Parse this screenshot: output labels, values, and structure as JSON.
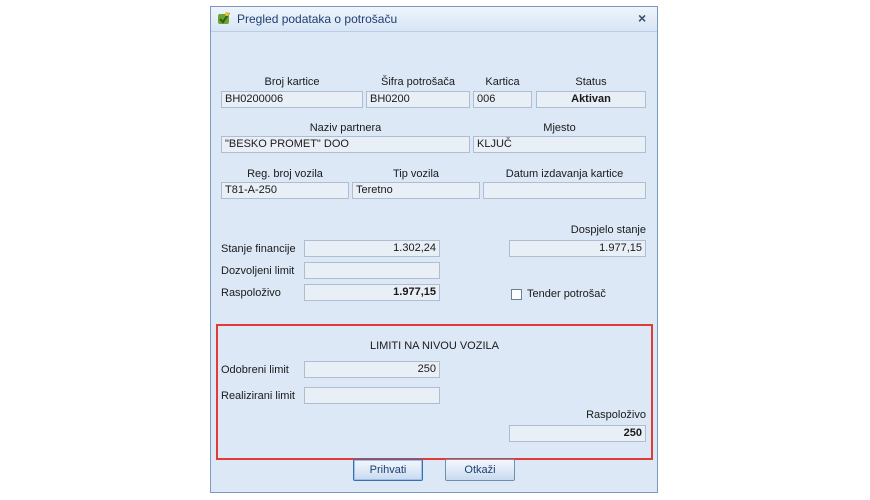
{
  "window": {
    "title": "Pregled podataka o potrošaču",
    "close_glyph": "×",
    "icon": "app-icon"
  },
  "card": {
    "labels": {
      "card_number": "Broj kartice",
      "customer_code": "Šifra potrošača",
      "card": "Kartica",
      "status": "Status"
    },
    "values": {
      "card_number": "BH0200006",
      "customer_code": "BH0200",
      "card": "006",
      "status": "Aktivan"
    }
  },
  "partner": {
    "labels": {
      "name": "Naziv partnera",
      "place": "Mjesto"
    },
    "values": {
      "name": "\"BESKO PROMET\" DOO",
      "place": "KLJUČ"
    }
  },
  "vehicle": {
    "labels": {
      "reg": "Reg. broj vozila",
      "type": "Tip vozila",
      "issue_date": "Datum izdavanja kartice"
    },
    "values": {
      "reg": "T81-A-250",
      "type": "Teretno",
      "issue_date": ""
    }
  },
  "finance": {
    "labels": {
      "state": "Stanje financije",
      "allowed": "Dozvoljeni limit",
      "available": "Raspoloživo",
      "due": "Dospjelo stanje",
      "tender": "Tender potrošač"
    },
    "values": {
      "state": "1.302,24",
      "allowed": "",
      "available": "1.977,15",
      "due": "1.977,15"
    },
    "tender_checked": false
  },
  "vehicle_limits": {
    "heading": "LIMITI NA NIVOU VOZILA",
    "labels": {
      "approved": "Odobreni limit",
      "realized": "Realizirani limit",
      "available": "Raspoloživo"
    },
    "values": {
      "approved": "250",
      "realized": "",
      "available": "250"
    }
  },
  "buttons": {
    "accept": "Prihvati",
    "cancel": "Otkaži"
  },
  "colors": {
    "highlight_border": "#e03b36",
    "window_bg": "#dce8f6",
    "title_text": "#1e3f72"
  }
}
